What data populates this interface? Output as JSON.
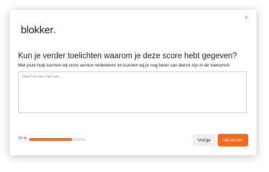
{
  "modal": {
    "close_icon": "close-icon",
    "close_glyph": "×",
    "brand": {
      "name": "blokker",
      "dot": ".",
      "dot_color": "#f2711c"
    },
    "question": "Kun je verder toelichten waarom je deze score hebt gegeven?",
    "subtitle": "Met jouw hulp kunnen wij onze service verbeteren en kunnen wij je nog beter van dienst zijn in de toekomst!",
    "comment": {
      "placeholder": "Deel het hier met ons...",
      "value": ""
    },
    "progress": {
      "label": "75 %",
      "percent": 75,
      "color": "#f26a24"
    },
    "buttons": {
      "previous": "Vorige",
      "submit": "Versturen"
    },
    "accent_color": "#f26a24"
  }
}
